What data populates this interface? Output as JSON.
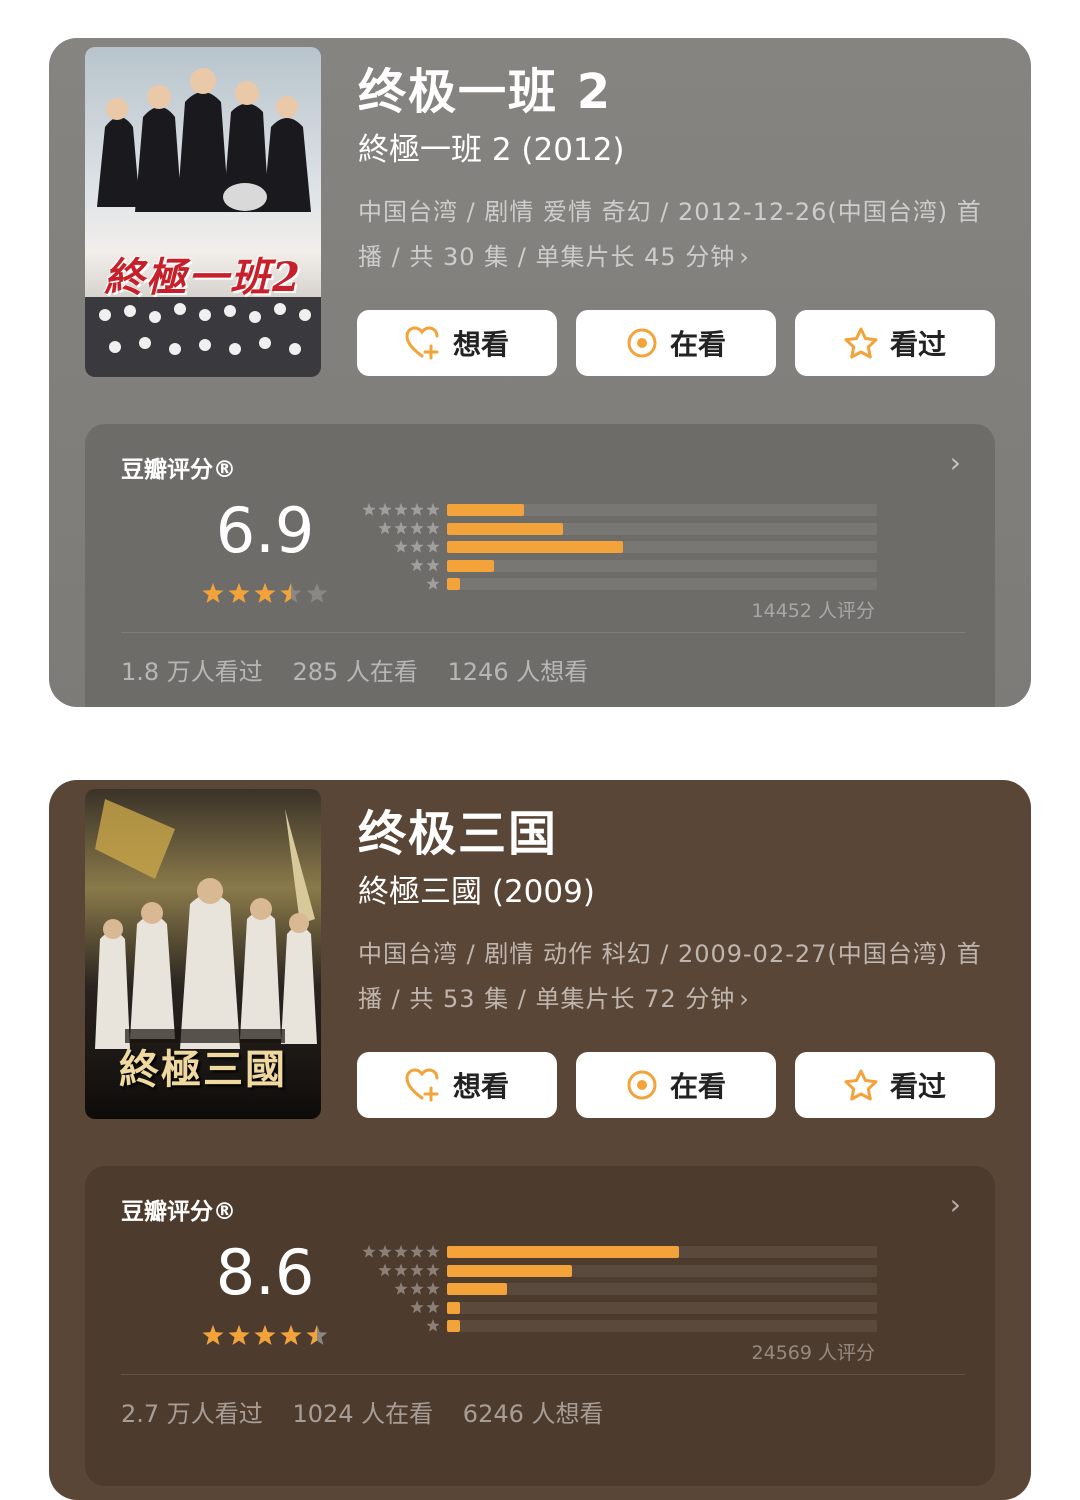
{
  "colors": {
    "accent": "#f4a23a",
    "star_empty": "#8a8884",
    "button_icon": "#f4a23a"
  },
  "items": [
    {
      "poster_title": "終極一班2",
      "title": "终极一班 2",
      "original_title": "終極一班 2 (2012)",
      "meta": "中国台湾 / 剧情 爱情 奇幻 / 2012-12-26(中国台湾) 首播 / 共 30 集 / 单集片长 45 分钟",
      "buttons": {
        "want": "想看",
        "watching": "在看",
        "watched": "看过"
      },
      "rating_label": "豆瓣评分®",
      "score": "6.9",
      "score_stars": 3.5,
      "distribution": [
        0.18,
        0.27,
        0.41,
        0.11,
        0.03
      ],
      "count": "14452 人评分",
      "stats": {
        "watched": "1.8 万人看过",
        "watching": "285 人在看",
        "want": "1246 人想看"
      }
    },
    {
      "poster_title": "終極三國",
      "title": "终极三国",
      "original_title": "終極三國 (2009)",
      "meta": "中国台湾 / 剧情 动作 科幻 / 2009-02-27(中国台湾) 首播 / 共 53 集 / 单集片长 72 分钟",
      "buttons": {
        "want": "想看",
        "watching": "在看",
        "watched": "看过"
      },
      "rating_label": "豆瓣评分®",
      "score": "8.6",
      "score_stars": 4.5,
      "distribution": [
        0.54,
        0.29,
        0.14,
        0.03,
        0.03
      ],
      "count": "24569 人评分",
      "stats": {
        "watched": "2.7 万人看过",
        "watching": "1024 人在看",
        "want": "6246 人想看"
      }
    }
  ]
}
